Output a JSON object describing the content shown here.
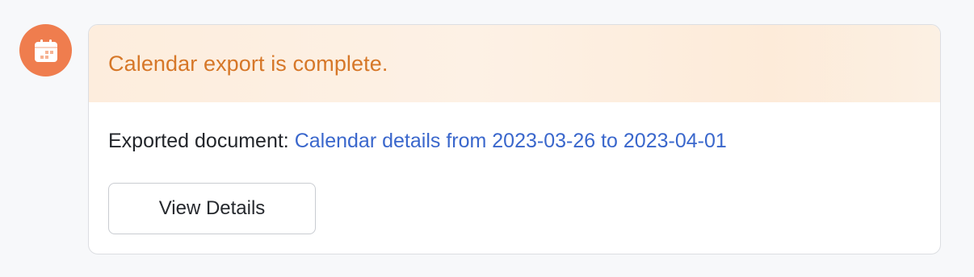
{
  "notification": {
    "icon": "calendar-icon",
    "icon_bg_color": "#ef7d4e",
    "title": "Calendar export is complete.",
    "title_color": "#d67728",
    "document_label": "Exported document: ",
    "document_link": "Calendar details from 2023-03-26 to 2023-04-01",
    "link_color": "#3a67cc",
    "button_label": "View Details"
  }
}
